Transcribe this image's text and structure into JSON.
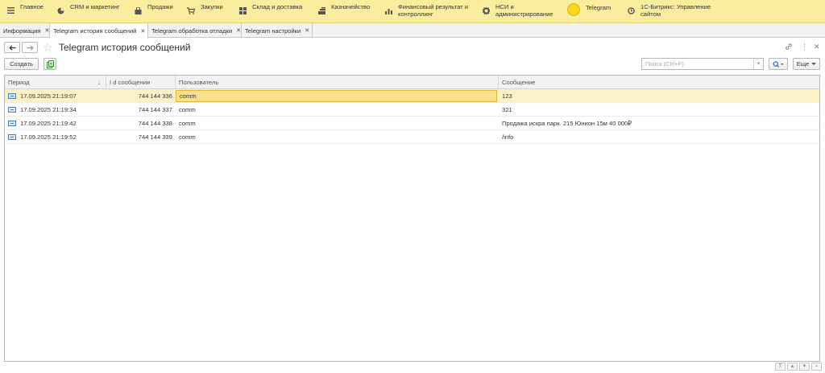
{
  "sections": [
    {
      "label": "Главное",
      "icon": "menu-icon"
    },
    {
      "label": "CRM и маркетинг",
      "icon": "pie-chart-icon"
    },
    {
      "label": "Продажи",
      "icon": "bag-icon"
    },
    {
      "label": "Закупки",
      "icon": "cart-icon"
    },
    {
      "label": "Склад и доставка",
      "icon": "warehouse-icon"
    },
    {
      "label": "Казначейство",
      "icon": "money-icon"
    },
    {
      "label": "Финансовый результат и контроллинг",
      "icon": "bar-chart-icon"
    },
    {
      "label": "НСИ и администрирование",
      "icon": "gear-icon"
    },
    {
      "label": "Telegram",
      "icon": "coin-icon"
    },
    {
      "label": "1С-Битрикс: Управление сайтом",
      "icon": "bitrix-icon"
    }
  ],
  "tabs": [
    {
      "label": "Информация"
    },
    {
      "label": "Telegram история сообщений"
    },
    {
      "label": "Telegram обработка отладки"
    },
    {
      "label": "Telegram настройки"
    }
  ],
  "page": {
    "title": "Telegram история сообщений",
    "create_label": "Создать",
    "more_label": "Еще",
    "search_placeholder": "Поиск (Ctrl+F)",
    "search_clear": "×"
  },
  "table": {
    "columns": [
      "Период",
      "I d сообщения",
      "Пользователь",
      "Сообщение"
    ],
    "sort_indicator": "↓",
    "rows": [
      {
        "period": "17.09.2025 21:19:07",
        "id": "744 144 336",
        "user": "comm",
        "message": "123"
      },
      {
        "period": "17.09.2025 21:19:34",
        "id": "744 144 337",
        "user": "comm",
        "message": "321"
      },
      {
        "period": "17.09.2025 21:19:42",
        "id": "744 144 338",
        "user": "comm",
        "message": "Продажа искра парк. 215 Юнион 15м 40 000₽"
      },
      {
        "period": "17.09.2025 21:19:52",
        "id": "744 144 339",
        "user": "comm",
        "message": "/info"
      }
    ]
  },
  "colors": {
    "section_bar": "#fbed9e",
    "selected_row": "#fbf1c6",
    "focused_cell": "#f9e08e"
  }
}
